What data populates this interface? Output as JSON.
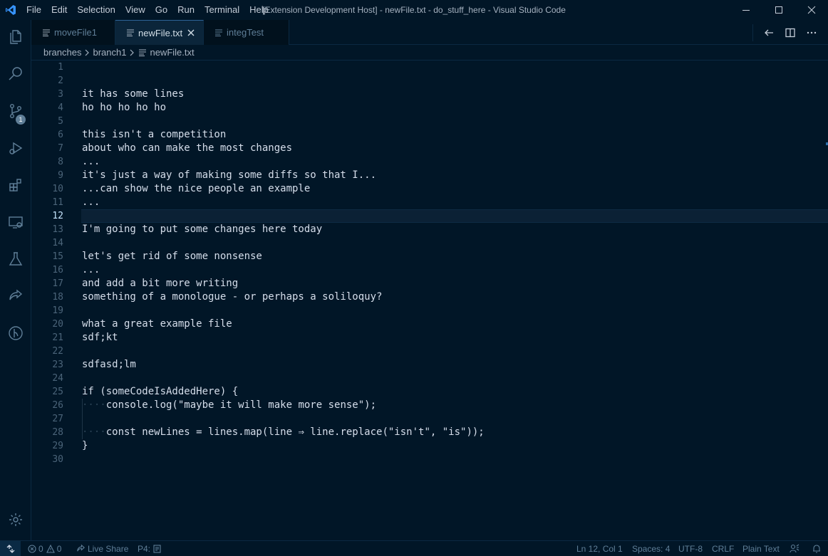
{
  "titlebar": {
    "menu": [
      "File",
      "Edit",
      "Selection",
      "View",
      "Go",
      "Run",
      "Terminal",
      "Help"
    ],
    "title": "[Extension Development Host] - newFile.txt - do_stuff_here - Visual Studio Code"
  },
  "activity": {
    "source_control_badge": "1"
  },
  "tabs": [
    {
      "label": "moveFile1",
      "active": false
    },
    {
      "label": "newFile.txt",
      "active": true
    },
    {
      "label": "integTest",
      "active": false
    }
  ],
  "breadcrumb": [
    "branches",
    "branch1",
    "newFile.txt"
  ],
  "editor": {
    "active_line": 12,
    "lines": [
      {
        "n": "1",
        "text": ""
      },
      {
        "n": "2",
        "text": ""
      },
      {
        "n": "3",
        "text": "it has some lines"
      },
      {
        "n": "4",
        "text": "ho ho ho ho ho"
      },
      {
        "n": "5",
        "text": ""
      },
      {
        "n": "6",
        "text": "this isn't a competition"
      },
      {
        "n": "7",
        "text": "about who can make the most changes"
      },
      {
        "n": "8",
        "text": "..."
      },
      {
        "n": "9",
        "text": "it's just a way of making some diffs so that I..."
      },
      {
        "n": "10",
        "text": "...can show the nice people an example"
      },
      {
        "n": "11",
        "text": "..."
      },
      {
        "n": "12",
        "text": ""
      },
      {
        "n": "13",
        "text": "I'm going to put some changes here today"
      },
      {
        "n": "14",
        "text": ""
      },
      {
        "n": "15",
        "text": "let's get rid of some nonsense"
      },
      {
        "n": "16",
        "text": "..."
      },
      {
        "n": "17",
        "text": "and add a bit more writing"
      },
      {
        "n": "18",
        "text": "something of a monologue - or perhaps a soliloquy?"
      },
      {
        "n": "19",
        "text": ""
      },
      {
        "n": "20",
        "text": "what a great example file"
      },
      {
        "n": "21",
        "text": "sdf;kt"
      },
      {
        "n": "22",
        "text": ""
      },
      {
        "n": "23",
        "text": "sdfasd;lm"
      },
      {
        "n": "24",
        "text": ""
      },
      {
        "n": "25",
        "text": "if (someCodeIsAddedHere) {"
      },
      {
        "n": "26",
        "indent": "····",
        "text": "console.log(\"maybe it will make more sense\");"
      },
      {
        "n": "27",
        "text": ""
      },
      {
        "n": "28",
        "indent": "····",
        "text": "const newLines = lines.map(line ⇒ line.replace(\"isn't\", \"is\"));"
      },
      {
        "n": "29",
        "text": "}"
      },
      {
        "n": "30",
        "text": ""
      }
    ]
  },
  "status": {
    "errors": "0",
    "warnings": "0",
    "live_share": "Live Share",
    "p4": "P4:",
    "position": "Ln 12, Col 1",
    "spaces": "Spaces: 4",
    "encoding": "UTF-8",
    "eol": "CRLF",
    "language": "Plain Text"
  },
  "colors": {
    "background": "#011627",
    "text": "#d6deeb",
    "line_number": "#4b6479",
    "accent": "#2d6497"
  }
}
